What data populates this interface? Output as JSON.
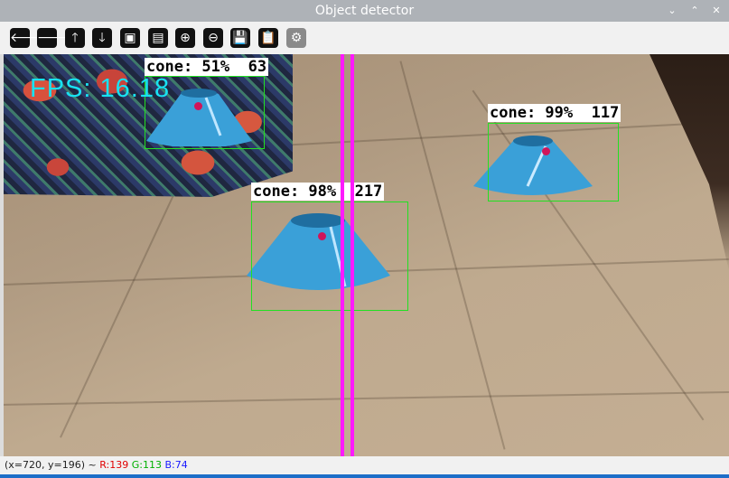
{
  "window": {
    "title": "Object detector",
    "controls": [
      "chevron-down",
      "chevron-up",
      "close"
    ],
    "control_glyphs": [
      "⌄",
      "⌃",
      "✕"
    ]
  },
  "toolbar": {
    "buttons": [
      {
        "name": "pan-left",
        "glyph": "🡐"
      },
      {
        "name": "pan-right",
        "glyph": "🡒"
      },
      {
        "name": "pan-up",
        "glyph": "🡑"
      },
      {
        "name": "pan-down",
        "glyph": "🡓"
      },
      {
        "name": "zoom-to-window",
        "glyph": "▣"
      },
      {
        "name": "zoom-to-image",
        "glyph": "▤"
      },
      {
        "name": "zoom-in",
        "glyph": "⊕"
      },
      {
        "name": "zoom-out",
        "glyph": "⊖"
      },
      {
        "name": "save-image",
        "glyph": "💾"
      },
      {
        "name": "copy-clipboard",
        "glyph": "📋"
      },
      {
        "name": "properties",
        "glyph": "⚙"
      }
    ]
  },
  "overlay": {
    "fps_text": "FPS: 16.18",
    "detections": [
      {
        "label": "cone: 51%  63"
      },
      {
        "label": "cone: 99%  117"
      },
      {
        "label": "cone: 98%  217"
      }
    ],
    "line_color": "#ff19ff",
    "box_color": "#22e022",
    "fps_color": "#18e2f2"
  },
  "status_bar": {
    "coords": "(x=720, y=196) ~",
    "r": "R:139",
    "g": "G:113",
    "b": "B:74"
  }
}
